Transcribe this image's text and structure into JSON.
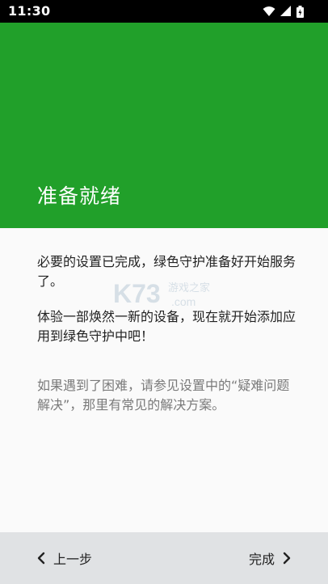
{
  "status_bar": {
    "time": "11:30",
    "icons": [
      "wifi-icon",
      "signal-icon",
      "battery-icon"
    ]
  },
  "header": {
    "title": "准备就绪",
    "background": "#21a02a"
  },
  "content": {
    "paragraph1": "必要的设置已完成，绿色守护准备好开始服务了。",
    "paragraph2": "体验一部焕然一新的设备，现在就开始添加应用到绿色守护中吧！",
    "paragraph3": "如果遇到了困难，请参见设置中的“疑难问题解决”，那里有常见的解决方案。"
  },
  "watermark": {
    "logo": "K73",
    "site": "游戏之家",
    "domain": ".com"
  },
  "footer": {
    "back_label": "上一步",
    "next_label": "完成"
  }
}
